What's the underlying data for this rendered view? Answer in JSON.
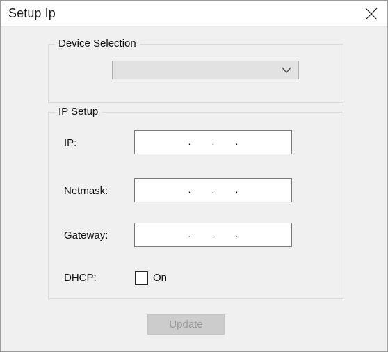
{
  "window": {
    "title": "Setup Ip",
    "close_icon": "close-icon",
    "background_color": "#f0f0f0",
    "titlebar_color": "#ffffff",
    "border_color": "#9b9b9b"
  },
  "device_selection": {
    "legend": "Device Selection",
    "combo": {
      "value": "",
      "placeholder": "",
      "arrow_icon": "chevron-down-icon",
      "background_color": "#e2e2e2",
      "border_color": "#adadad"
    }
  },
  "ip_setup": {
    "legend": "IP Setup",
    "fields": [
      {
        "label": "IP:",
        "name": "ip-address-input",
        "octets": [
          "",
          "",
          "",
          ""
        ],
        "separator": "."
      },
      {
        "label": "Netmask:",
        "name": "netmask-input",
        "octets": [
          "",
          "",
          "",
          ""
        ],
        "separator": "."
      },
      {
        "label": "Gateway:",
        "name": "gateway-input",
        "octets": [
          "",
          "",
          "",
          ""
        ],
        "separator": "."
      }
    ],
    "dhcp": {
      "label": "DHCP:",
      "checkbox_label": "On",
      "checked": false
    }
  },
  "footer": {
    "update_label": "Update",
    "update_enabled": false,
    "update_bg_color": "#cccccc",
    "update_text_color": "#9a9a9a"
  }
}
